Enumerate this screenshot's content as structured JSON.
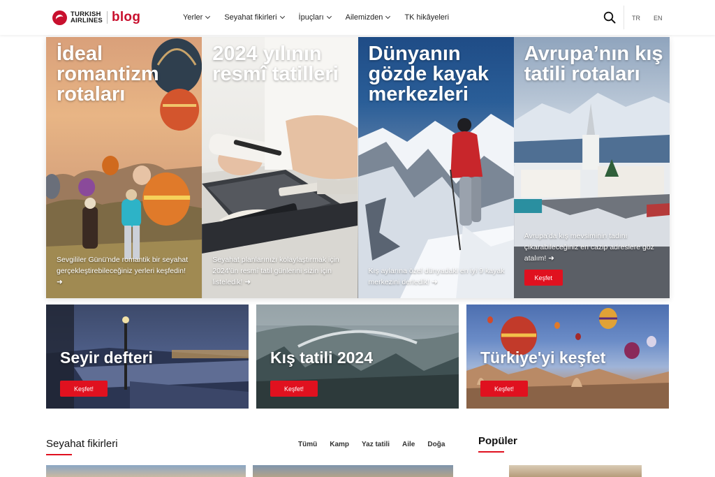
{
  "header": {
    "logo_line1": "TURKISH",
    "logo_line2": "AIRLINES",
    "logo_blog": "blog",
    "nav": [
      {
        "label": "Yerler",
        "has_dropdown": true
      },
      {
        "label": "Seyahat fikirleri",
        "has_dropdown": true
      },
      {
        "label": "İpuçları",
        "has_dropdown": true
      },
      {
        "label": "Ailemizden",
        "has_dropdown": true
      },
      {
        "label": "TK hikâyeleri",
        "has_dropdown": false
      }
    ],
    "search_icon": "search-icon",
    "languages": [
      "TR",
      "EN"
    ]
  },
  "hero": [
    {
      "title": "İdeal romantizm rotaları",
      "desc": "Sevgililer Günü'nde romantik bir seyahat gerçekleştirebileceğiniz yerleri keşfedin! ➜",
      "scene": "hot-air-balloons-couple"
    },
    {
      "title": "2024 yılının resmî tatilleri",
      "desc": "Seyahat planlarınızı kolaylaştırmak için 2024'ün resmî tatil günlerini sizin için listeledik! ➜",
      "scene": "calendar-planning-desk"
    },
    {
      "title": "Dünyanın gözde kayak merkezleri",
      "desc": "Kış aylarına özel dünyadaki en iyi 9 kayak merkezini derledik! ➜",
      "scene": "skier-snowy-mountains"
    },
    {
      "title": "Avrupa’nın kış tatili rotaları",
      "desc": "Avrupa'da kış mevsiminin tadını çıkarabileceğiniz en cazip adreslere göz atalım! ➜",
      "button": "Keşfet",
      "scene": "snowy-european-town"
    }
  ],
  "featured": [
    {
      "title": "Seyir defteri",
      "button": "Keşfet!"
    },
    {
      "title": "Kış tatili 2024",
      "button": "Keşfet!"
    },
    {
      "title": "Türkiye'yi keşfet",
      "button": "Keşfet!"
    }
  ],
  "section": {
    "title": "Seyahat fikirleri",
    "filters": [
      "Tümü",
      "Kamp",
      "Yaz tatili",
      "Aile",
      "Doğa"
    ]
  },
  "popular": {
    "title": "Popüler"
  },
  "colors": {
    "brand_red": "#c8102e",
    "button_red": "#e0111f"
  }
}
